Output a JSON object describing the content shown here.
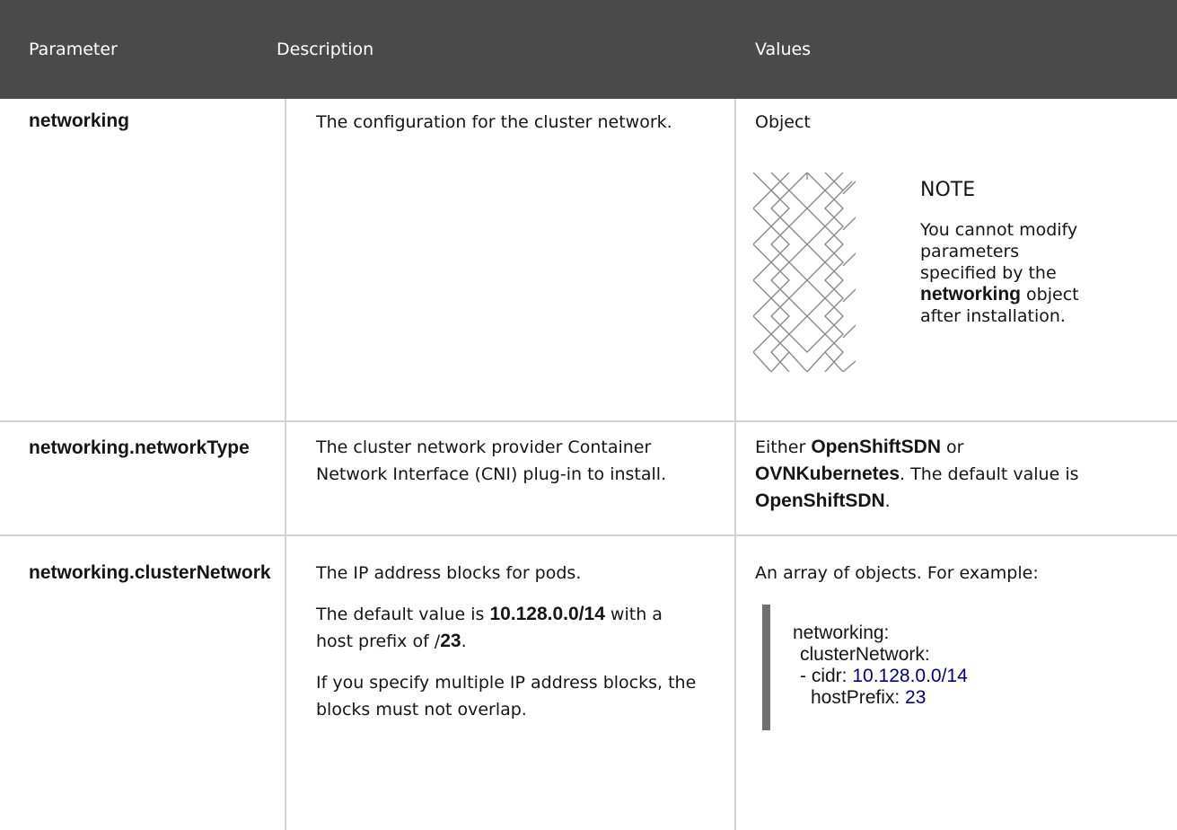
{
  "header": {
    "parameter": "Parameter",
    "description": "Description",
    "values": "Values"
  },
  "rows": [
    {
      "parameter": "networking",
      "description": "The configuration for the cluster network.",
      "values": "Object",
      "note": {
        "title": "NOTE",
        "text_before": "You cannot modify parameters specified by the ",
        "bold": "networking",
        "text_after": " object after installation."
      }
    },
    {
      "parameter": "networking.networkType",
      "description": "The cluster network provider Container Network Interface (CNI) plug-in to install.",
      "values": {
        "prefix": "Either ",
        "opt1": "OpenShiftSDN",
        "mid": " or ",
        "opt2": "OVNKubernetes",
        "mid2": ". The default value is ",
        "default": "OpenShiftSDN",
        "suffix": "."
      }
    },
    {
      "parameter": "networking.clusterNetwork",
      "description": {
        "p1": "The IP address blocks for pods.",
        "p2_prefix": "The default value is ",
        "p2_bold1": "10.128.0.0/14",
        "p2_mid": " with a host prefix of /",
        "p2_bold2": "23",
        "p2_suffix": ".",
        "p3": "If you specify multiple IP address blocks, the blocks must not overlap."
      },
      "values": {
        "intro": "An array of objects. For example:",
        "code": {
          "line1": "networking:",
          "line2": "clusterNetwork:",
          "line3_key": "- cidr: ",
          "line3_val": "10.128.0.0/14",
          "line4_key": "hostPrefix: ",
          "line4_val": "23"
        }
      }
    }
  ]
}
